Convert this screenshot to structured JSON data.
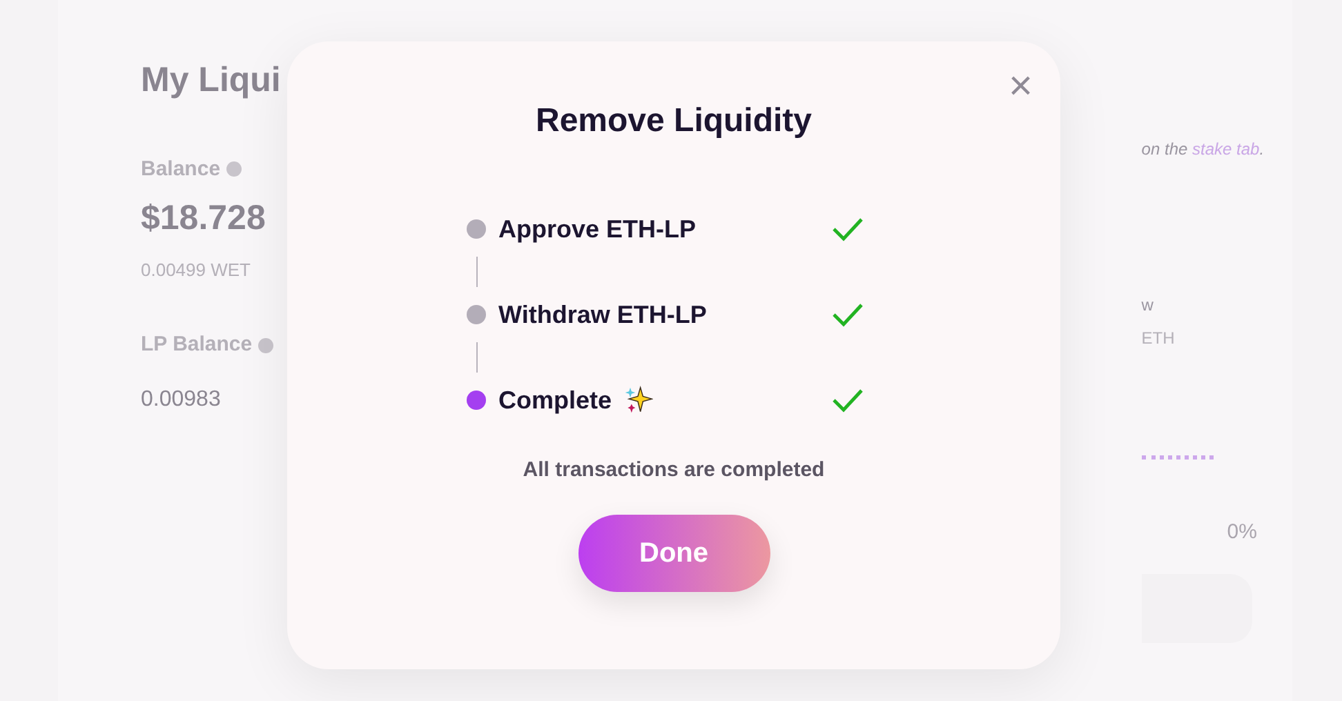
{
  "background": {
    "title": "My Liqui",
    "balance_label": "Balance",
    "balance_usd": "$18.728",
    "balance_weth": "0.00499 WET",
    "lp_balance_label": "LP Balance",
    "lp_balance": "0.00983",
    "hint_prefix": "on the ",
    "hint_link": "stake tab",
    "hint_suffix": ".",
    "column_label": "w",
    "column_value": "ETH",
    "percent": "0%"
  },
  "modal": {
    "title": "Remove Liquidity",
    "close": "×",
    "steps": [
      {
        "label": "Approve ETH-LP",
        "color": "#b3adb8",
        "done": true,
        "sparkle": false
      },
      {
        "label": "Withdraw ETH-LP",
        "color": "#b3adb8",
        "done": true,
        "sparkle": false
      },
      {
        "label": "Complete",
        "color": "#a43ff0",
        "done": true,
        "sparkle": true
      }
    ],
    "message": "All transactions are completed",
    "button": "Done"
  }
}
